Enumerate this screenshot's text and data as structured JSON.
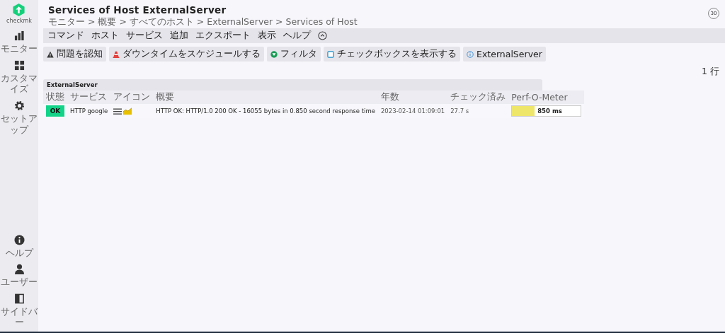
{
  "sidebar": {
    "logo_text": "checkmk",
    "items": [
      {
        "kind": "monitor",
        "label": "モニター"
      },
      {
        "kind": "customize",
        "label": "カスタマイズ"
      },
      {
        "kind": "setup",
        "label": "セットアップ"
      }
    ],
    "bottom_items": [
      {
        "kind": "help",
        "label": "ヘルプ"
      },
      {
        "kind": "user",
        "label": "ユーザー"
      },
      {
        "kind": "sidebar",
        "label": "サイドバー"
      }
    ]
  },
  "header": {
    "title": "Services of Host ExternalServer",
    "breadcrumb": "モニター > 概要 > すべてのホスト > ExternalServer > Services of Host",
    "refresh": "30"
  },
  "menu": [
    "コマンド",
    "ホスト",
    "サービス",
    "追加",
    "エクスポート",
    "表示",
    "ヘルプ"
  ],
  "actions": [
    {
      "kind": "warning",
      "label": "問題を認知"
    },
    {
      "kind": "cone",
      "label": "ダウンタイムをスケジュールする"
    },
    {
      "kind": "filter",
      "label": "フィルタ"
    },
    {
      "kind": "checkbox",
      "label": "チェックボックスを表示する"
    },
    {
      "kind": "info",
      "label": "ExternalServer"
    }
  ],
  "row_count": "1 行",
  "table": {
    "group": "ExternalServer",
    "columns": [
      "状態",
      "サービス",
      "アイコン",
      "概要",
      "年数",
      "チェック済み",
      "Perf-O-Meter"
    ],
    "rows": [
      {
        "state": "OK",
        "service": "HTTP google",
        "summary": "HTTP OK: HTTP/1.0 200 OK - 16055 bytes in 0.850 second response time",
        "age": "2023-02-14 01:09:01",
        "checked": "27.7 s",
        "perf": {
          "level": 0.33,
          "reading": "850 ms"
        }
      }
    ]
  }
}
